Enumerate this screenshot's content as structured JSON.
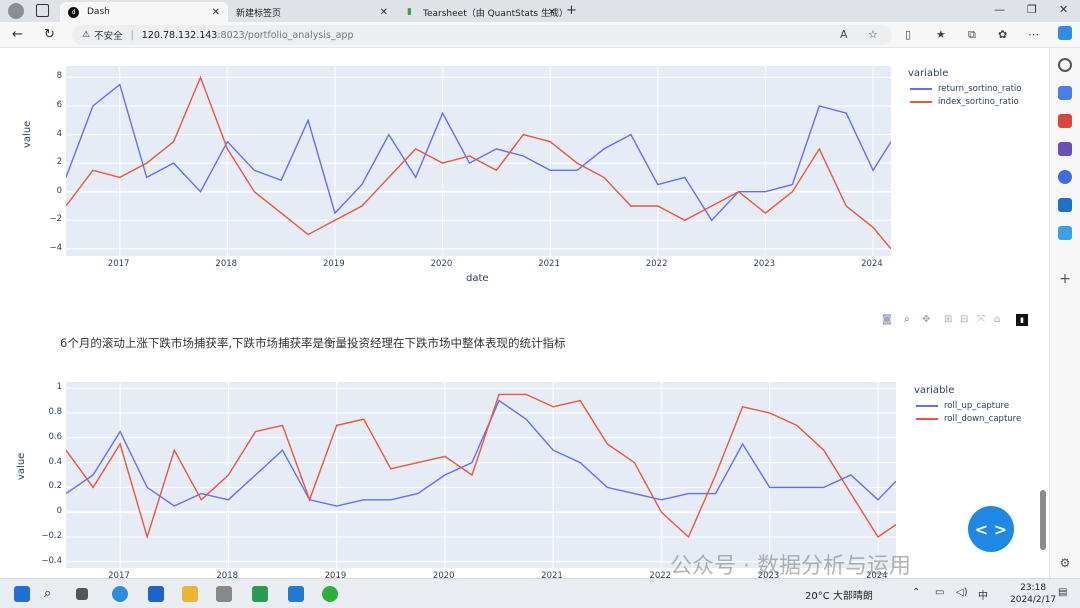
{
  "browser": {
    "tabs": [
      {
        "label": "Dash",
        "active": true
      },
      {
        "label": "新建标签页",
        "active": false
      },
      {
        "label": "Tearsheet（由 QuantStats 生成）",
        "active": false
      }
    ],
    "address": {
      "security_label": "不安全",
      "host": "120.78.132.143",
      "path": ":8023/portfolio_analysis_app"
    }
  },
  "chart1": {
    "legend_title": "variable",
    "xlabel": "date",
    "ylabel": "value",
    "x_ticks": [
      "2017",
      "2018",
      "2019",
      "2020",
      "2021",
      "2022",
      "2023",
      "2024"
    ],
    "y_ticks": [
      "8",
      "6",
      "4",
      "2",
      "0",
      "−2",
      "−4"
    ]
  },
  "description": "6个月的滚动上涨下跌市场捕获率,下跌市场捕获率是衡量投资经理在下跌市场中整体表现的统计指标",
  "chart2": {
    "legend_title": "variable",
    "ylabel": "value",
    "x_ticks": [
      "2017",
      "2018",
      "2019",
      "2020",
      "2021",
      "2022",
      "2023",
      "2024"
    ],
    "y_ticks": [
      "1",
      "0.8",
      "0.6",
      "0.4",
      "0.2",
      "0",
      "−0.2",
      "−0.4"
    ]
  },
  "chart_data": [
    {
      "type": "line",
      "x": [
        "2016-07",
        "2016-10",
        "2017-01",
        "2017-04",
        "2017-07",
        "2017-10",
        "2018-01",
        "2018-04",
        "2018-07",
        "2018-10",
        "2019-01",
        "2019-04",
        "2019-07",
        "2019-10",
        "2020-01",
        "2020-04",
        "2020-07",
        "2020-10",
        "2021-01",
        "2021-04",
        "2021-07",
        "2021-10",
        "2022-01",
        "2022-04",
        "2022-07",
        "2022-10",
        "2023-01",
        "2023-04",
        "2023-07",
        "2023-10",
        "2024-01",
        "2024-03"
      ],
      "series": [
        {
          "name": "return_sortino_ratio",
          "color": "#636efa",
          "values": [
            1.0,
            6.0,
            7.5,
            1.0,
            2.0,
            0.0,
            3.5,
            1.5,
            0.8,
            5.0,
            -1.5,
            0.5,
            4.0,
            1.0,
            5.5,
            2.0,
            3.0,
            2.5,
            1.5,
            1.5,
            3.0,
            4.0,
            0.5,
            1.0,
            -2.0,
            0.0,
            0.0,
            0.5,
            6.0,
            5.5,
            1.5,
            3.5
          ]
        },
        {
          "name": "index_sortino_ratio",
          "color": "#ef553b",
          "values": [
            -1.0,
            1.5,
            1.0,
            2.0,
            3.5,
            8.0,
            3.0,
            0.0,
            -1.5,
            -3.0,
            -2.0,
            -1.0,
            1.0,
            3.0,
            2.0,
            2.5,
            1.5,
            4.0,
            3.5,
            2.0,
            1.0,
            -1.0,
            -1.0,
            -2.0,
            -1.0,
            0.0,
            -1.5,
            0.0,
            3.0,
            -1.0,
            -2.5,
            -4.0
          ]
        }
      ],
      "xlabel": "date",
      "ylabel": "value",
      "ylim": [
        -4.5,
        8.8
      ],
      "legend": "right",
      "grid": true
    },
    {
      "type": "line",
      "x": [
        "2016-07",
        "2016-10",
        "2017-01",
        "2017-04",
        "2017-07",
        "2017-10",
        "2018-01",
        "2018-04",
        "2018-07",
        "2018-10",
        "2019-01",
        "2019-04",
        "2019-07",
        "2019-10",
        "2020-01",
        "2020-04",
        "2020-07",
        "2020-10",
        "2021-01",
        "2021-04",
        "2021-07",
        "2021-10",
        "2022-01",
        "2022-04",
        "2022-07",
        "2022-10",
        "2023-01",
        "2023-04",
        "2023-07",
        "2023-10",
        "2024-01",
        "2024-03"
      ],
      "series": [
        {
          "name": "roll_up_capture",
          "color": "#636efa",
          "values": [
            0.15,
            0.3,
            0.65,
            0.2,
            0.05,
            0.15,
            0.1,
            0.3,
            0.5,
            0.1,
            0.05,
            0.1,
            0.1,
            0.15,
            0.3,
            0.4,
            0.9,
            0.75,
            0.5,
            0.4,
            0.2,
            0.15,
            0.1,
            0.15,
            0.15,
            0.55,
            0.2,
            0.2,
            0.2,
            0.3,
            0.1,
            0.25
          ]
        },
        {
          "name": "roll_down_capture",
          "color": "#ef553b",
          "values": [
            0.5,
            0.2,
            0.55,
            -0.2,
            0.5,
            0.1,
            0.3,
            0.65,
            0.7,
            0.1,
            0.7,
            0.75,
            0.35,
            0.4,
            0.45,
            0.3,
            0.95,
            0.95,
            0.85,
            0.9,
            0.55,
            0.4,
            0.0,
            -0.2,
            0.3,
            0.85,
            0.8,
            0.7,
            0.5,
            0.15,
            -0.2,
            -0.1
          ]
        }
      ],
      "ylabel": "value",
      "ylim": [
        -0.45,
        1.05
      ],
      "legend": "right",
      "grid": true
    }
  ],
  "watermark": "公众号 · 数据分析与运用",
  "taskbar": {
    "weather": "20°C 大部晴朗",
    "ime": "中",
    "time": "23:18",
    "date": "2024/2/17"
  },
  "colors": {
    "plot_bg": "#e5ecf6",
    "series_blue": "#636efa",
    "series_red": "#ef553b",
    "fab": "#1e88e5"
  }
}
